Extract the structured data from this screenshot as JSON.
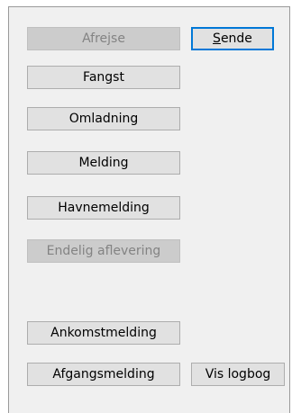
{
  "buttons": {
    "afrejse": {
      "label": "Afrejse",
      "enabled": false
    },
    "sende": {
      "label_first_letter": "S",
      "label_rest": "ende",
      "enabled": true,
      "is_default": true
    },
    "fangst": {
      "label": "Fangst",
      "enabled": true
    },
    "omladning": {
      "label": "Omladning",
      "enabled": true
    },
    "melding": {
      "label": "Melding",
      "enabled": true
    },
    "havnemelding": {
      "label": "Havnemelding",
      "enabled": true
    },
    "endelig_aflevering": {
      "label": "Endelig aflevering",
      "enabled": false
    },
    "ankomstmelding": {
      "label": "Ankomstmelding",
      "enabled": true
    },
    "afgangsmelding": {
      "label": "Afgangsmelding",
      "enabled": true
    },
    "vis_logbog": {
      "label": "Vis logbog",
      "enabled": true
    }
  }
}
